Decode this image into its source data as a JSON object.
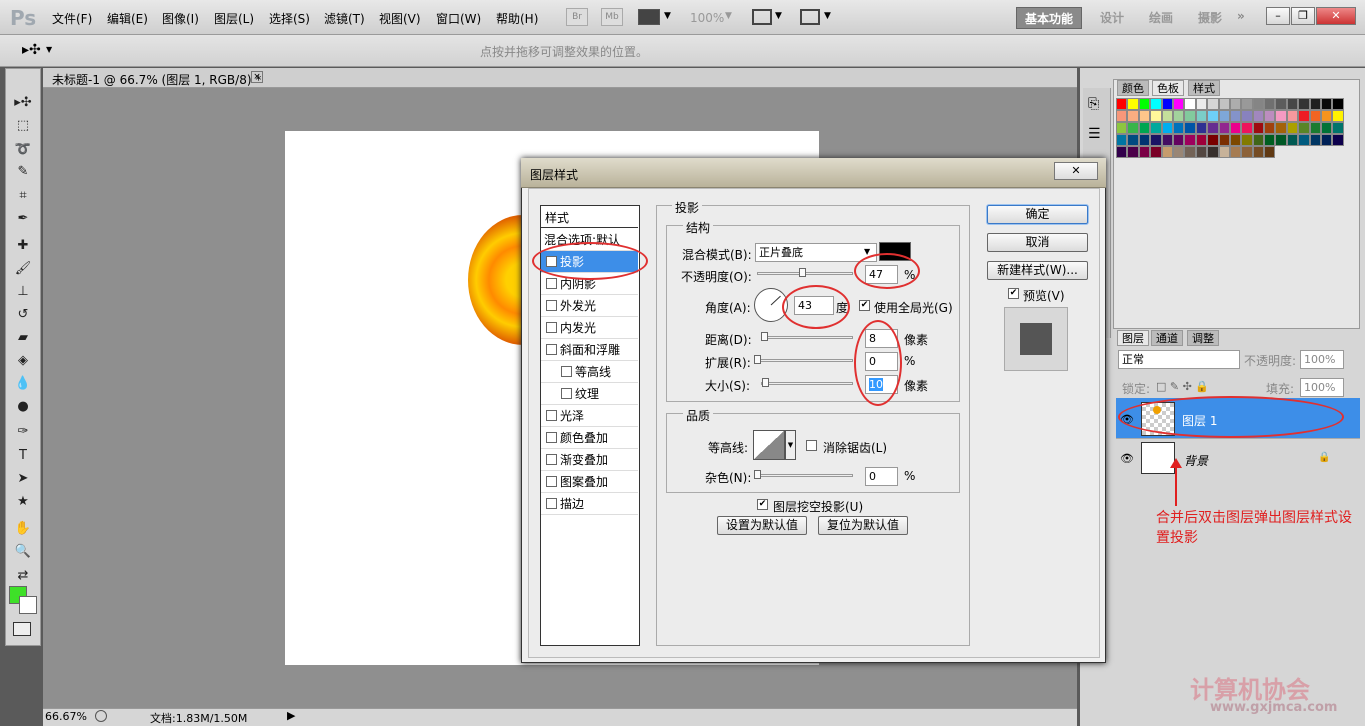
{
  "app": {
    "logo": "Ps"
  },
  "menu": [
    "文件(F)",
    "编辑(E)",
    "图像(I)",
    "图层(L)",
    "选择(S)",
    "滤镜(T)",
    "视图(V)",
    "窗口(W)",
    "帮助(H)"
  ],
  "toolbar": {
    "br": "Br",
    "mb": "Mb",
    "zoom": "100%"
  },
  "workspaces": [
    "基本功能",
    "设计",
    "绘画",
    "摄影"
  ],
  "window_controls": {
    "min": "–",
    "restore": "❐",
    "close": "✕"
  },
  "options": {
    "hint": "点按并拖移可调整效果的位置。"
  },
  "document": {
    "tab": "未标题-1 @ 66.7% (图层 1, RGB/8) *",
    "close": "×"
  },
  "status": {
    "zoom": "66.67%",
    "doc": "文档:1.83M/1.50M"
  },
  "swatches_panel": {
    "tabs": [
      "颜色",
      "色板",
      "样式"
    ],
    "active": 1
  },
  "swatch_colors": [
    "#ff0000",
    "#ffff00",
    "#00ff00",
    "#00ffff",
    "#0000ff",
    "#ff00ff",
    "#ffffff",
    "#ebebeb",
    "#d6d6d6",
    "#c2c2c2",
    "#adadad",
    "#999999",
    "#858585",
    "#707070",
    "#5c5c5c",
    "#474747",
    "#333333",
    "#1f1f1f",
    "#0a0a0a",
    "#000000",
    "#f7977a",
    "#f9ad81",
    "#fdc68a",
    "#fff79a",
    "#c4df9b",
    "#a2d39c",
    "#82ca9d",
    "#7bcdc8",
    "#6ecff6",
    "#7ea7d8",
    "#8493ca",
    "#8882be",
    "#a187be",
    "#bc8dbf",
    "#f49ac2",
    "#f6989d",
    "#ed1c24",
    "#f26522",
    "#f7941d",
    "#fff200",
    "#8dc63f",
    "#39b54a",
    "#00a651",
    "#00a99d",
    "#00aeef",
    "#0072bc",
    "#0054a6",
    "#2e3192",
    "#662d91",
    "#92278f",
    "#ec008c",
    "#ed145b",
    "#9e0b0f",
    "#a0410d",
    "#a36209",
    "#aba000",
    "#598527",
    "#1a7b30",
    "#007236",
    "#00746b",
    "#0076a3",
    "#004b80",
    "#003471",
    "#1b1464",
    "#440e62",
    "#630460",
    "#9e005d",
    "#9e0039",
    "#790000",
    "#7b2e00",
    "#7d4900",
    "#827b00",
    "#406618",
    "#005e20",
    "#005826",
    "#005952",
    "#005b7f",
    "#003663",
    "#002157",
    "#0d004c",
    "#32004b",
    "#4b0049",
    "#7b0046",
    "#7a0026",
    "#c69c6d",
    "#998675",
    "#736357",
    "#534741",
    "#37302d",
    "#c7b299",
    "#a67c52",
    "#8c6239",
    "#754c24",
    "#603913"
  ],
  "layers_panel": {
    "tabs": [
      "图层",
      "通道",
      "调整"
    ],
    "blend": "正常",
    "opacity_label": "不透明度:",
    "opacity": "100%",
    "lock_label": "锁定:",
    "fill_label": "填充:",
    "fill": "100%",
    "layers": [
      {
        "name": "图层 1",
        "selected": true
      },
      {
        "name": "背景",
        "selected": false
      }
    ]
  },
  "dialog": {
    "title": "图层样式",
    "close": "✕",
    "styles_header": "样式",
    "styles": [
      {
        "label": "混合选项:默认",
        "checkbox": false,
        "checked": false,
        "indent": 0
      },
      {
        "label": "投影",
        "checkbox": true,
        "checked": true,
        "indent": 0,
        "selected": true
      },
      {
        "label": "内阴影",
        "checkbox": true,
        "checked": false,
        "indent": 0
      },
      {
        "label": "外发光",
        "checkbox": true,
        "checked": false,
        "indent": 0
      },
      {
        "label": "内发光",
        "checkbox": true,
        "checked": false,
        "indent": 0
      },
      {
        "label": "斜面和浮雕",
        "checkbox": true,
        "checked": false,
        "indent": 0
      },
      {
        "label": "等高线",
        "checkbox": true,
        "checked": false,
        "indent": 1
      },
      {
        "label": "纹理",
        "checkbox": true,
        "checked": false,
        "indent": 1
      },
      {
        "label": "光泽",
        "checkbox": true,
        "checked": false,
        "indent": 0
      },
      {
        "label": "颜色叠加",
        "checkbox": true,
        "checked": false,
        "indent": 0
      },
      {
        "label": "渐变叠加",
        "checkbox": true,
        "checked": false,
        "indent": 0
      },
      {
        "label": "图案叠加",
        "checkbox": true,
        "checked": false,
        "indent": 0
      },
      {
        "label": "描边",
        "checkbox": true,
        "checked": false,
        "indent": 0
      }
    ],
    "section_title": "投影",
    "structure": "结构",
    "blend_label": "混合模式(B):",
    "blend_value": "正片叠底",
    "shadow_color": "#000000",
    "opacity_label": "不透明度(O):",
    "opacity_value": "47",
    "opacity_unit": "%",
    "opacity_fraction": 0.47,
    "angle_label": "角度(A):",
    "angle_value": "43",
    "angle_unit": "度",
    "angle_deg": 43,
    "global_light": "使用全局光(G)",
    "distance_label": "距离(D):",
    "distance_value": "8",
    "distance_unit": "像素",
    "distance_fraction": 0.03,
    "spread_label": "扩展(R):",
    "spread_value": "0",
    "spread_unit": "%",
    "spread_fraction": 0.0,
    "size_label": "大小(S):",
    "size_value": "10",
    "size_unit": "像素",
    "size_fraction": 0.04,
    "quality": "品质",
    "contour_label": "等高线:",
    "antialias": "消除锯齿(L)",
    "noise_label": "杂色(N):",
    "noise_value": "0",
    "noise_unit": "%",
    "noise_fraction": 0.0,
    "knockout": "图层挖空投影(U)",
    "set_default": "设置为默认值",
    "reset_default": "复位为默认值",
    "ok": "确定",
    "cancel": "取消",
    "new_style": "新建样式(W)...",
    "preview": "预览(V)"
  },
  "annotation": "合并后双击图层弹出图层样式设置投影",
  "watermark": "计算机协会",
  "watermark_url": "www.gxjmca.com"
}
